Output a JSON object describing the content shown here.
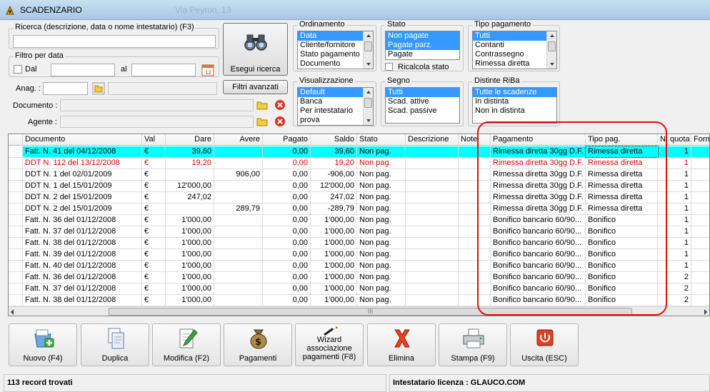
{
  "window": {
    "title": "SCADENZARIO",
    "ghost_tab": "Via Peyron, 13"
  },
  "search": {
    "legend": "Ricerca (descrizione, data o nome intestatario) (F3)",
    "value": ""
  },
  "date_filter": {
    "legend": "Filtro per data",
    "from_label": "Dal",
    "to_label": "al",
    "from_value": "",
    "to_value": ""
  },
  "anag": {
    "label": "Anag. :",
    "value": ""
  },
  "documento": {
    "label": "Documento :"
  },
  "agente": {
    "label": "Agente :"
  },
  "buttons": {
    "search": "Esegui ricerca",
    "advanced": "Filtri avanzati"
  },
  "ordinamento": {
    "legend": "Ordinamento",
    "items": [
      "Data",
      "Cliente/fornitore",
      "Stato pagamento",
      "Documento"
    ],
    "selected": [
      0
    ]
  },
  "stato": {
    "legend": "Stato",
    "items": [
      "Non pagate",
      "Pagate parz.",
      "Pagate"
    ],
    "selected": [
      0,
      1
    ],
    "recalc_label": "Ricalcola stato"
  },
  "tipo_pagamento": {
    "legend": "Tipo pagamento",
    "items": [
      "Tutti",
      "Contanti",
      "Contrassegno",
      "Rimessa diretta"
    ],
    "selected": [
      0
    ]
  },
  "visualizzazione": {
    "legend": "Visualizzazione",
    "items": [
      "Default",
      "Banca",
      "Per intestatario",
      "prova"
    ],
    "selected": [
      0
    ]
  },
  "segno": {
    "legend": "Segno",
    "items": [
      "Tutti",
      "Scad. attive",
      "Scad. passive"
    ],
    "selected": [
      0
    ]
  },
  "distinte": {
    "legend": "Distinte RiBa",
    "items": [
      "Tutte le scadenze",
      "In distinta",
      "Non in distinta"
    ],
    "selected": [
      0
    ]
  },
  "table": {
    "columns": [
      "Documento",
      "Val",
      "Dare",
      "Avere",
      "Pagato",
      "Saldo",
      "Stato",
      "Descrizione",
      "Note",
      "Pagamento",
      "Tipo pag.",
      "N. quota",
      "Form"
    ],
    "rows": [
      {
        "doc": "Fatt. N. 41 del 04/12/2008",
        "val": "€",
        "dare": "39,60",
        "avere": "",
        "pagato": "0,00",
        "saldo": "39,60",
        "stato": "Non pag.",
        "desc": "",
        "note": "",
        "pag": "Rimessa diretta 30gg D.F.",
        "tipo": "Rimessa diretta",
        "quota": "1",
        "style": "selected"
      },
      {
        "doc": "DDT N. 112 del 13/12/2008",
        "val": "€",
        "dare": "19,20",
        "avere": "",
        "pagato": "0,00",
        "saldo": "19,20",
        "stato": "Non pag.",
        "desc": "",
        "note": "",
        "pag": "Rimessa diretta 30gg D.F.",
        "tipo": "Rimessa diretta",
        "quota": "1",
        "style": "red"
      },
      {
        "doc": "DDT N. 1 del 02/01/2009",
        "val": "€",
        "dare": "",
        "avere": "906,00",
        "pagato": "0,00",
        "saldo": "-906,00",
        "stato": "Non pag.",
        "desc": "",
        "note": "",
        "pag": "Rimessa diretta 30gg D.F.",
        "tipo": "Rimessa diretta",
        "quota": "1",
        "style": ""
      },
      {
        "doc": "DDT N. 1 del 15/01/2009",
        "val": "€",
        "dare": "12'000,00",
        "avere": "",
        "pagato": "0,00",
        "saldo": "12'000,00",
        "stato": "Non pag.",
        "desc": "",
        "note": "",
        "pag": "Rimessa diretta 30gg D.F.",
        "tipo": "Rimessa diretta",
        "quota": "1",
        "style": ""
      },
      {
        "doc": "DDT N. 2 del 15/01/2009",
        "val": "€",
        "dare": "247,02",
        "avere": "",
        "pagato": "0,00",
        "saldo": "247,02",
        "stato": "Non pag.",
        "desc": "",
        "note": "",
        "pag": "Rimessa diretta 30gg D.F.",
        "tipo": "Rimessa diretta",
        "quota": "1",
        "style": ""
      },
      {
        "doc": "DDT N. 2 del 15/01/2009",
        "val": "€",
        "dare": "",
        "avere": "289,79",
        "pagato": "0,00",
        "saldo": "-289,79",
        "stato": "Non pag.",
        "desc": "",
        "note": "",
        "pag": "Rimessa diretta 30gg D.F.",
        "tipo": "Rimessa diretta",
        "quota": "1",
        "style": ""
      },
      {
        "doc": "Fatt. N. 36 del 01/12/2008",
        "val": "€",
        "dare": "1'000,00",
        "avere": "",
        "pagato": "0,00",
        "saldo": "1'000,00",
        "stato": "Non pag.",
        "desc": "",
        "note": "",
        "pag": "Bonifico bancario 60/90...",
        "tipo": "Bonifico",
        "quota": "1",
        "style": ""
      },
      {
        "doc": "Fatt. N. 37 del 01/12/2008",
        "val": "€",
        "dare": "1'000,00",
        "avere": "",
        "pagato": "0,00",
        "saldo": "1'000,00",
        "stato": "Non pag.",
        "desc": "",
        "note": "",
        "pag": "Bonifico bancario 60/90...",
        "tipo": "Bonifico",
        "quota": "1",
        "style": ""
      },
      {
        "doc": "Fatt. N. 38 del 01/12/2008",
        "val": "€",
        "dare": "1'000,00",
        "avere": "",
        "pagato": "0,00",
        "saldo": "1'000,00",
        "stato": "Non pag.",
        "desc": "",
        "note": "",
        "pag": "Bonifico bancario 60/90...",
        "tipo": "Bonifico",
        "quota": "1",
        "style": ""
      },
      {
        "doc": "Fatt. N. 39 del 01/12/2008",
        "val": "€",
        "dare": "1'000,00",
        "avere": "",
        "pagato": "0,00",
        "saldo": "1'000,00",
        "stato": "Non pag.",
        "desc": "",
        "note": "",
        "pag": "Bonifico bancario 60/90...",
        "tipo": "Bonifico",
        "quota": "1",
        "style": ""
      },
      {
        "doc": "Fatt. N. 40 del 01/12/2008",
        "val": "€",
        "dare": "1'000,00",
        "avere": "",
        "pagato": "0,00",
        "saldo": "1'000,00",
        "stato": "Non pag.",
        "desc": "",
        "note": "",
        "pag": "Bonifico bancario 60/90...",
        "tipo": "Bonifico",
        "quota": "1",
        "style": ""
      },
      {
        "doc": "Fatt. N. 36 del 01/12/2008",
        "val": "€",
        "dare": "1'000,00",
        "avere": "",
        "pagato": "0,00",
        "saldo": "1'000,00",
        "stato": "Non pag.",
        "desc": "",
        "note": "",
        "pag": "Bonifico bancario 60/90...",
        "tipo": "Bonifico",
        "quota": "2",
        "style": ""
      },
      {
        "doc": "Fatt. N. 37 del 01/12/2008",
        "val": "€",
        "dare": "1'000,00",
        "avere": "",
        "pagato": "0,00",
        "saldo": "1'000,00",
        "stato": "Non pag.",
        "desc": "",
        "note": "",
        "pag": "Bonifico bancario 60/90...",
        "tipo": "Bonifico",
        "quota": "2",
        "style": ""
      },
      {
        "doc": "Fatt. N. 38 del 01/12/2008",
        "val": "€",
        "dare": "1'000,00",
        "avere": "",
        "pagato": "0,00",
        "saldo": "1'000,00",
        "stato": "Non pag.",
        "desc": "",
        "note": "",
        "pag": "Bonifico bancario 60/90...",
        "tipo": "Bonifico",
        "quota": "2",
        "style": ""
      }
    ],
    "scroll_marker": "III"
  },
  "toolbar": {
    "nuovo": "Nuovo (F4)",
    "duplica": "Duplica",
    "modifica": "Modifica (F2)",
    "pagamenti": "Pagamenti",
    "wizard": "Wizard associazione pagamenti (F8)",
    "elimina": "Elimina",
    "stampa": "Stampa (F9)",
    "uscita": "Uscita (ESC)"
  },
  "status": {
    "records": "113 record trovati",
    "license": "Intestatario licenza : GLAUCO.COM"
  },
  "colors": {
    "selected_row": "#00ffff",
    "red_row": "#e00000",
    "list_selection": "#3399ff",
    "annotation": "#e01010"
  }
}
